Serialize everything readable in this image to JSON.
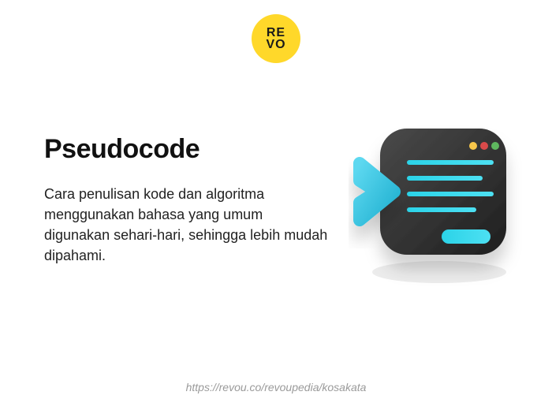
{
  "logo": {
    "line1": "RE",
    "line2": "VO"
  },
  "heading": "Pseudocode",
  "description": "Cara penulisan kode dan algoritma menggunakan bahasa yang umum digunakan sehari-hari, sehingga lebih mudah dipahami.",
  "footer_url": "https://revou.co/revoupedia/kosakata",
  "illustration": {
    "terminal_bg": "#2d2d2d",
    "line_color": "#2bd3e8",
    "dot_colors": [
      "#f7c64a",
      "#d94a4a",
      "#5fb85f"
    ],
    "chevron_color": "#3bc6ea",
    "shadow_color": "#e8e8e8"
  }
}
